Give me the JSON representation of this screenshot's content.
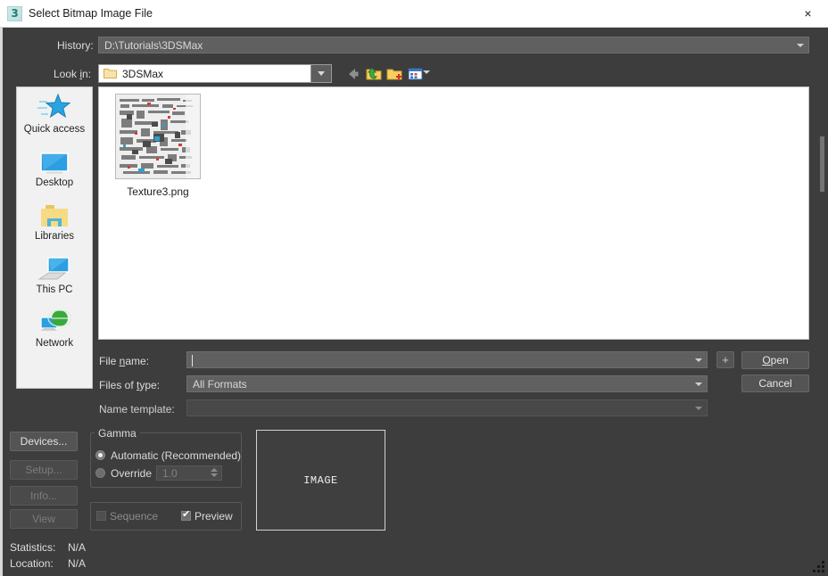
{
  "window": {
    "title": "Select Bitmap Image File",
    "icon": "max-3-icon",
    "close_label": "×"
  },
  "history": {
    "label": "History:",
    "value": "D:\\Tutorials\\3DSMax",
    "dropdown_icon": "chevron-down-icon"
  },
  "lookin": {
    "label_pre": "Look ",
    "label_accel": "i",
    "label_post": "n:",
    "value": "3DSMax",
    "folder_icon": "folder-icon",
    "dropdown_icon": "chevron-down-icon"
  },
  "toolbar": {
    "items": [
      {
        "name": "back-icon",
        "tooltip": "Back"
      },
      {
        "name": "up-folder-icon",
        "tooltip": "Up One Level"
      },
      {
        "name": "new-folder-icon",
        "tooltip": "Create New Folder"
      },
      {
        "name": "views-icon",
        "tooltip": "Views"
      }
    ]
  },
  "places": {
    "items": [
      {
        "label": "Quick access",
        "icon": "star-icon"
      },
      {
        "label": "Desktop",
        "icon": "monitor-icon"
      },
      {
        "label": "Libraries",
        "icon": "libraries-folder-icon"
      },
      {
        "label": "This PC",
        "icon": "computer-icon"
      },
      {
        "label": "Network",
        "icon": "globe-network-icon"
      }
    ]
  },
  "filelist": {
    "files": [
      {
        "name": "Texture3.png",
        "icon": "image-thumbnail"
      }
    ]
  },
  "form": {
    "filename": {
      "label_pre": "File ",
      "label_accel": "n",
      "label_post": "ame:",
      "value": "",
      "placeholder": ""
    },
    "filetype": {
      "label_pre": "Files of ",
      "label_accel": "t",
      "label_post": "ype:",
      "value": "All Formats"
    },
    "nametemplate": {
      "label": "Name template:",
      "value": ""
    },
    "plus_label": "+",
    "open_label_pre": "",
    "open_accel": "O",
    "open_label_post": "pen",
    "cancel_label": "Cancel"
  },
  "sidebuttons": [
    {
      "label": "Devices...",
      "enabled": true
    },
    {
      "label": "Setup...",
      "enabled": false
    },
    {
      "label": "Info...",
      "enabled": false
    },
    {
      "label": "View",
      "enabled": false
    }
  ],
  "gamma": {
    "title": "Gamma",
    "automatic_label": "Automatic (Recommended)",
    "automatic_selected": true,
    "override_label": "Override",
    "override_selected": false,
    "override_value": "1.0"
  },
  "options": {
    "sequence_label": "Sequence",
    "sequence_checked": false,
    "sequence_enabled": false,
    "preview_label": "Preview",
    "preview_checked": true
  },
  "preview": {
    "placeholder_text": "IMAGE"
  },
  "footer": {
    "statistics_label": "Statistics:",
    "statistics_value": "N/A",
    "location_label": "Location:",
    "location_value": "N/A"
  },
  "colors": {
    "dialog_bg": "#3d3d3d",
    "titlebar_bg": "#ffffff",
    "field_bg": "#606060",
    "list_bg": "#ffffff",
    "places_bg": "#f1f1f1",
    "text": "#dcdcdc",
    "accent_folder": "#f5d47a"
  }
}
